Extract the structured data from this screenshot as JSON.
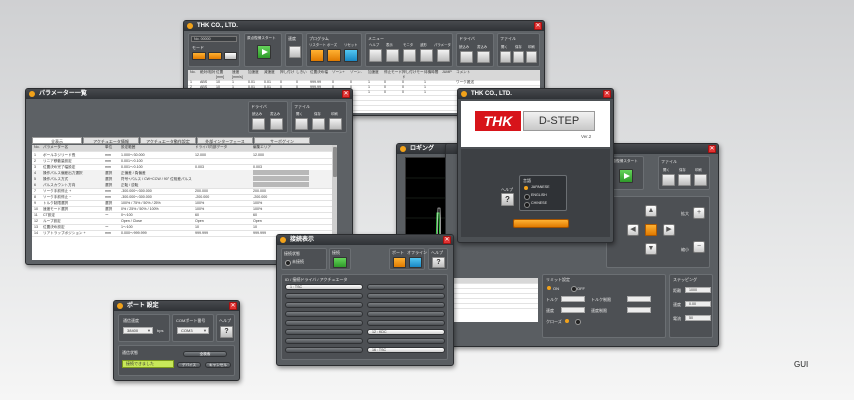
{
  "caption": "GUI",
  "main_window": {
    "title": "THK CO., LTD.",
    "node_label": "No. 00000",
    "mode_label": "モード",
    "start_button_label": "原点復帰スタート",
    "group_speed": "速度",
    "group_program": "プログラム",
    "program_buttons": [
      "リスタート",
      "ポーズ",
      "リセット"
    ],
    "group_menu": "メニュー",
    "menu_items": [
      "ヘルプ",
      "表示",
      "モニタ",
      "波形",
      "パラメータ"
    ],
    "group_drive": "ドライバ",
    "drive_items": [
      "読込み",
      "書込み"
    ],
    "group_file": "ファイル",
    "file_items": [
      "開く",
      "保存",
      "印刷"
    ],
    "table_headers": [
      "No.",
      "絶対/相対",
      "位置 [mm]",
      "速度 [mm/s]",
      "加速度",
      "減速度",
      "押し付け",
      "しきい",
      "位置決め幅",
      "ゾーン+",
      "ゾーン-",
      "加速度",
      "停止モード",
      "押し付けモード",
      "待機時間",
      "JUMP",
      "コメント"
    ],
    "table_rows": [
      [
        "1",
        "ABS",
        "10",
        "1",
        "0.01",
        "0.01",
        "0",
        "0",
        "999.99",
        "0",
        "0",
        "1",
        "0",
        "0",
        "1",
        "",
        "ワーク搬送"
      ],
      [
        "2",
        "ABS",
        "10",
        "1",
        "0.01",
        "0.01",
        "0",
        "0",
        "999.99",
        "0",
        "0",
        "1",
        "0",
        "0",
        "1",
        "",
        ""
      ],
      [
        "3",
        "ABS",
        "10",
        "1",
        "0.01",
        "0.01",
        "0",
        "0",
        "999.99",
        "0",
        "0",
        "1",
        "0",
        "0",
        "1",
        "",
        ""
      ]
    ]
  },
  "param_window": {
    "title": "パラメーター一覧",
    "group_drive": "ドライバ",
    "drive_items": [
      "読込み",
      "書込み"
    ],
    "group_file": "ファイル",
    "file_items": [
      "開く",
      "保存",
      "印刷"
    ],
    "tabs": [
      "全表示",
      "アクチュエータ情報",
      "アクチュエータ動作設定",
      "外部インターフェース",
      "サーボゲイン"
    ],
    "columns": [
      "No.",
      "パラメーター名",
      "単位",
      "設定範囲",
      "ドライバ内部データ",
      "編集エリア"
    ],
    "rows": [
      [
        "1",
        "ボールネジリード長",
        "mm",
        "1.000〜30.000",
        "12.000",
        "12.000"
      ],
      [
        "2",
        "リニア移動量設定",
        "mm",
        "0.001〜0.100",
        "",
        ""
      ],
      [
        "3",
        "位置決め完了幅設定",
        "mm",
        "0.001〜0.100",
        "0.003",
        "0.003"
      ],
      [
        "4",
        "操作パルス偏差出力選択",
        "選択",
        "正偏差 / 負偏差",
        "",
        ""
      ],
      [
        "5",
        "操作パルス方式",
        "選択",
        "符号+パルス / CW+CCW / 90° 位相差パルス",
        "",
        ""
      ],
      [
        "6",
        "パルスカウント方向",
        "選択",
        "正転 / 逆転",
        "",
        ""
      ],
      [
        "7",
        "ソーク手前停止 +",
        "mm",
        "-300.000〜300.000",
        "200.000",
        "200.000"
      ],
      [
        "8",
        "ソーク手前停止 −",
        "mm",
        "-300.000〜300.000",
        "-200.000",
        "-200.000"
      ],
      [
        "9",
        "トルク制限選択",
        "選択",
        "100% / 75% / 50% / 25%",
        "100%",
        "100%"
      ],
      [
        "10",
        "速度モード選択",
        "選択",
        "0% / 25% / 50% / 100%",
        "100%",
        "100%"
      ],
      [
        "11",
        "CT設定",
        "ー",
        "0〜100",
        "60",
        "60"
      ],
      [
        "12",
        "ループ設定",
        "",
        "Open / Close",
        "Open",
        "Open"
      ],
      [
        "13",
        "位置決め設定",
        "ー",
        "1〜100",
        "10",
        "10"
      ],
      [
        "14",
        "リアトラップポジション +",
        "mm",
        "0.000〜999.999",
        "999.999",
        "999.999"
      ]
    ]
  },
  "logging_window": {
    "title": "ロギング",
    "x_axis_label": "時間[msec]",
    "y_axis_label": "速度"
  },
  "splash_window": {
    "title": "THK CO., LTD.",
    "logo_text": "THK",
    "product_text": "D-STEP",
    "version": "Ver.2",
    "help_label": "ヘルプ",
    "lang_label": "言語",
    "languages": [
      "JAPANESE",
      "ENGLISH",
      "CHINESE"
    ],
    "selected_language": "JAPANESE"
  },
  "control_window": {
    "start_label": "原点復帰スタート",
    "group_file": "ファイル",
    "file_items": [
      "開く",
      "保存",
      "印刷"
    ],
    "zoom_in": "拡大",
    "zoom_out": "縮小",
    "table_label": "リミット設定",
    "radio_on": "ON",
    "radio_off": "OFF",
    "field_labels": [
      "トルク",
      "トルク制限",
      "速度",
      "速度制限",
      "クローズ"
    ],
    "stepping_label": "ステッピング",
    "stepping_labels": [
      "距離",
      "速度",
      "電流"
    ],
    "stepping_values": [
      "1000",
      "0.00",
      "50"
    ]
  },
  "connection_window": {
    "title": "接続表示",
    "status_label": "接続状態",
    "status_value": "未接続",
    "connect_label": "接続",
    "port_label": "ポート",
    "offline_label": "オフライン",
    "help_label": "ヘルプ",
    "list_header": "ID / 接続ドライバ / アクチュエータ",
    "slots_left": [
      "1 : TSC",
      "",
      "",
      "",
      "",
      "",
      "",
      ""
    ],
    "slots_right": [
      "",
      "",
      "",
      "",
      "",
      "12 : KDC",
      "",
      "16 : TSC"
    ]
  },
  "port_window": {
    "title": "ポート 設定",
    "baud_label": "通信速度",
    "baud_value": "38400",
    "baud_unit": "bps",
    "com_label": "COMポート番号",
    "com_value": "COM3",
    "help_label": "ヘルプ",
    "status_label": "通信状態",
    "status_value": "接続できました",
    "search_button": "全検索",
    "buttons": [
      "デバイス",
      "キャンセル"
    ]
  }
}
